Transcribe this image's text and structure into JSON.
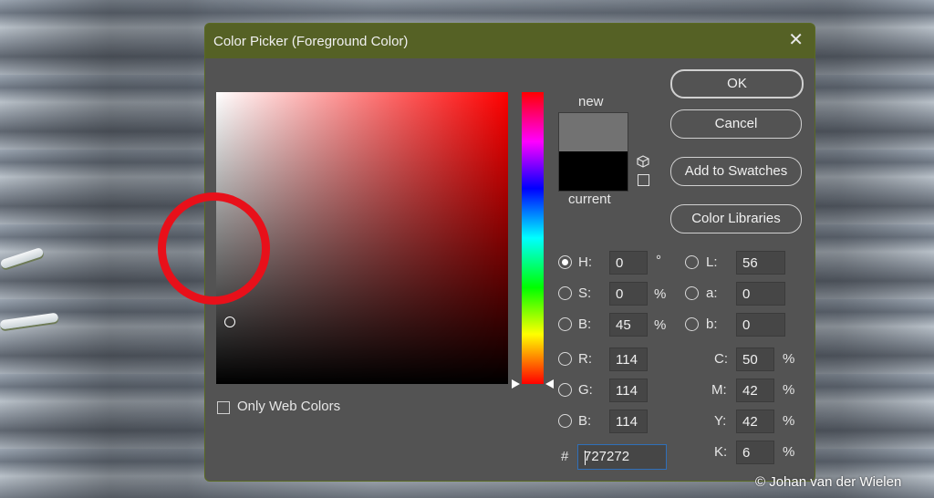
{
  "window": {
    "title": "Color Picker (Foreground Color)"
  },
  "buttons": {
    "ok": "OK",
    "cancel": "Cancel",
    "add_swatches": "Add to Swatches",
    "libraries": "Color Libraries"
  },
  "preview": {
    "new_label": "new",
    "current_label": "current",
    "new_color": "#727272",
    "current_color": "#000000"
  },
  "hsb": {
    "h": {
      "label": "H:",
      "value": "0",
      "unit": "°"
    },
    "s": {
      "label": "S:",
      "value": "0",
      "unit": "%"
    },
    "b": {
      "label": "B:",
      "value": "45",
      "unit": "%"
    }
  },
  "lab": {
    "l": {
      "label": "L:",
      "value": "56"
    },
    "a": {
      "label": "a:",
      "value": "0"
    },
    "b": {
      "label": "b:",
      "value": "0"
    }
  },
  "rgb": {
    "r": {
      "label": "R:",
      "value": "114"
    },
    "g": {
      "label": "G:",
      "value": "114"
    },
    "b": {
      "label": "B:",
      "value": "114"
    }
  },
  "cmyk": {
    "c": {
      "label": "C:",
      "value": "50",
      "unit": "%"
    },
    "m": {
      "label": "M:",
      "value": "42",
      "unit": "%"
    },
    "y": {
      "label": "Y:",
      "value": "42",
      "unit": "%"
    },
    "k": {
      "label": "K:",
      "value": "6",
      "unit": "%"
    }
  },
  "hex": {
    "label": "#",
    "value": "727272"
  },
  "web_colors": {
    "label": "Only Web Colors",
    "checked": false
  },
  "icons": {
    "close": "close-icon",
    "cube": "cube-icon",
    "square": "web-safe-square-icon"
  },
  "colors": {
    "titlebar": "#556125",
    "dialog_bg": "#535353",
    "annotation": "#e8101a"
  },
  "credit": "© Johan van der Wielen"
}
